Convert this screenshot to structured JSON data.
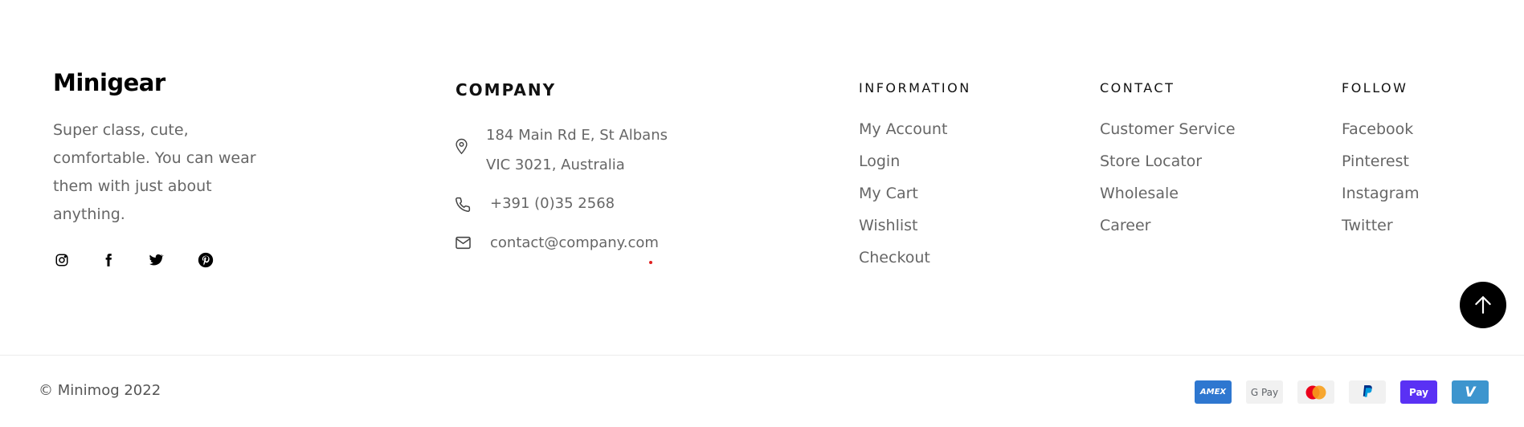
{
  "brand": {
    "name": "Minigear",
    "about": "Super class, cute, comfortable. You can wear them with just about anything."
  },
  "social": {
    "icons": [
      "instagram-icon",
      "facebook-icon",
      "twitter-icon",
      "pinterest-icon"
    ]
  },
  "company": {
    "title": "COMPANY",
    "address_line1": "184 Main Rd E, St Albans",
    "address_line2": "VIC 3021, Australia",
    "phone": "+391 (0)35 2568",
    "email": "contact@company.com"
  },
  "information": {
    "title": "INFORMATION",
    "links": [
      "My Account",
      "Login",
      "My Cart",
      "Wishlist",
      "Checkout"
    ]
  },
  "contact": {
    "title": "CONTACT",
    "links": [
      "Customer Service",
      "Store Locator",
      "Wholesale",
      "Career"
    ]
  },
  "follow": {
    "title": "FOLLOW",
    "links": [
      "Facebook",
      "Pinterest",
      "Instagram",
      "Twitter"
    ]
  },
  "footer": {
    "copyright": "© Minimog 2022"
  },
  "payments": {
    "amex": "AMEX",
    "gpay": "G Pay",
    "shoppay": "Pay",
    "venmo": "V",
    "colors": {
      "amex": "#2e77d0",
      "gpay_bg": "#f1f1f1",
      "mastercard_red": "#eb001b",
      "mastercard_yellow": "#f79e1b",
      "paypal_bg": "#f1f1f1",
      "shoppay": "#5a31f4",
      "venmo": "#3d95ce"
    }
  }
}
